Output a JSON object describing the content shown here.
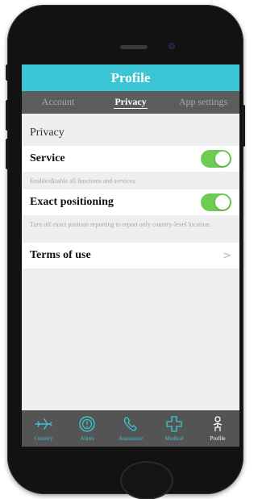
{
  "header": {
    "title": "Profile"
  },
  "tabs": [
    {
      "label": "Account",
      "active": false
    },
    {
      "label": "Privacy",
      "active": true
    },
    {
      "label": "App settings",
      "active": false
    }
  ],
  "section": {
    "title": "Privacy"
  },
  "settings": {
    "service": {
      "label": "Service",
      "enabled": true,
      "description": "Enable/disable all functions and services."
    },
    "exact_positioning": {
      "label": "Exact positioning",
      "enabled": true,
      "description": "Turn off exact position reporting to report only country-level location."
    },
    "terms": {
      "label": "Terms of use",
      "chevron": ">"
    }
  },
  "tabbar": {
    "items": [
      {
        "label": "Country",
        "icon": "airplane-icon"
      },
      {
        "label": "Alerts",
        "icon": "alert-icon"
      },
      {
        "label": "Assistance",
        "icon": "phone-icon"
      },
      {
        "label": "Medical",
        "icon": "medical-cross-icon"
      },
      {
        "label": "Profile",
        "icon": "person-icon"
      }
    ],
    "active": "Profile"
  },
  "colors": {
    "accent": "#3cc5d4",
    "toggle_on": "#6dcc54",
    "tab_bg": "#5c5c5c",
    "tabbar_bg": "#545454"
  }
}
